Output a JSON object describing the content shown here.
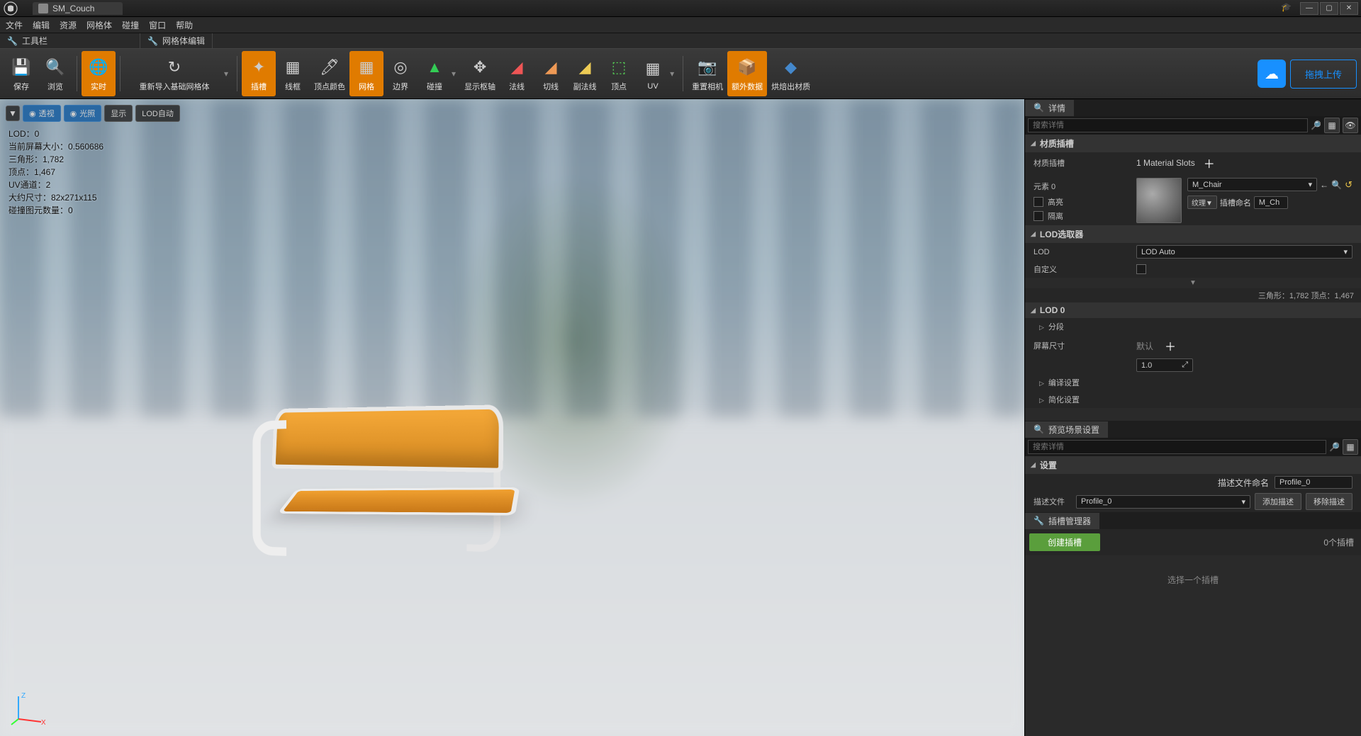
{
  "titlebar": {
    "tab_name": "SM_Couch"
  },
  "menu": {
    "file": "文件",
    "edit": "编辑",
    "asset": "资源",
    "mesh": "网格体",
    "collision": "碰撞",
    "window": "窗口",
    "help": "帮助"
  },
  "subhead": {
    "toolbar": "工具栏",
    "mesh_edit": "网格体编辑"
  },
  "toolbar": {
    "save": "保存",
    "browse": "浏览",
    "realtime": "实时",
    "reimport": "重新导入基础网格体",
    "sockets": "插槽",
    "wireframe": "线框",
    "vertex_color": "顶点颜色",
    "grid": "网格",
    "bounds": "边界",
    "collision": "碰撞",
    "pivot": "显示枢轴",
    "normals": "法线",
    "tangents": "切线",
    "binormals": "副法线",
    "vertices": "顶点",
    "uv": "UV",
    "reset_camera": "重置相机",
    "extra_data": "额外数据",
    "bake_material": "烘焙出材质",
    "upload": "拖拽上传"
  },
  "viewport": {
    "dropdown": "▼",
    "perspective": "透视",
    "lit": "光照",
    "show": "显示",
    "lod_auto": "LOD自动",
    "stats": {
      "lod": "LOD：0",
      "screen_size": "当前屏幕大小：0.560686",
      "triangles": "三角形：1,782",
      "vertices": "顶点：1,467",
      "uv_channels": "UV通道：2",
      "approx_size": "大约尺寸：82x271x115",
      "collision_prims": "碰撞图元数量：0"
    }
  },
  "panels": {
    "details_title": "详情",
    "preview_title": "预览场景设置",
    "socket_mgr_title": "插槽管理器",
    "search_placeholder": "搜索详情"
  },
  "material": {
    "header": "材质插槽",
    "label": "材质插槽",
    "slots_text": "1 Material Slots",
    "element0": "元素 0",
    "highlight": "高亮",
    "isolate": "隔离",
    "mat_name": "M_Chair",
    "texture_btn": "纹理▼",
    "slot_name_label": "插槽命名",
    "slot_name_value": "M_Ch"
  },
  "lod_picker": {
    "header": "LOD选取器",
    "lod_label": "LOD",
    "lod_value": "LOD Auto",
    "custom_label": "自定义"
  },
  "lod0": {
    "header": "LOD 0",
    "stats": "三角形：1,782  顶点：1,467",
    "sections": "分段",
    "screen_size": "屏幕尺寸",
    "default": "默认",
    "value": "1.0",
    "build_settings": "编译设置",
    "reduce_settings": "简化设置"
  },
  "settings": {
    "header": "设置",
    "profile_name_label": "描述文件命名",
    "profile_name_value": "Profile_0",
    "profile_label": "描述文件",
    "profile_value": "Profile_0",
    "add_profile": "添加描述",
    "remove_profile": "移除描述"
  },
  "sockets": {
    "create": "创建插槽",
    "count": "0个插槽",
    "select_hint": "选择一个插槽"
  }
}
